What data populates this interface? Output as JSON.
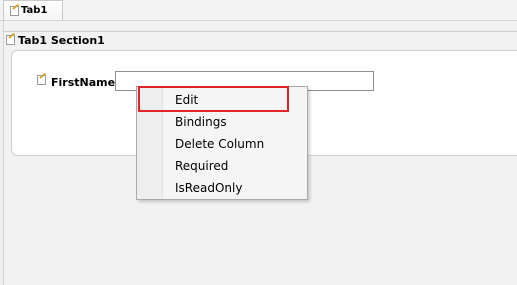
{
  "tab": {
    "label": "Tab1"
  },
  "section": {
    "title": "Tab1 Section1"
  },
  "field": {
    "label": "FirstName :",
    "value": ""
  },
  "context_menu": {
    "items": [
      "Edit",
      "Bindings",
      "Delete Column",
      "Required",
      "IsReadOnly"
    ],
    "highlighted": "Edit",
    "highlight_color": "#e0242b"
  },
  "icons": {
    "tab_icon": "edit-document-icon",
    "section_icon": "edit-document-icon",
    "field_icon": "edit-document-icon"
  }
}
